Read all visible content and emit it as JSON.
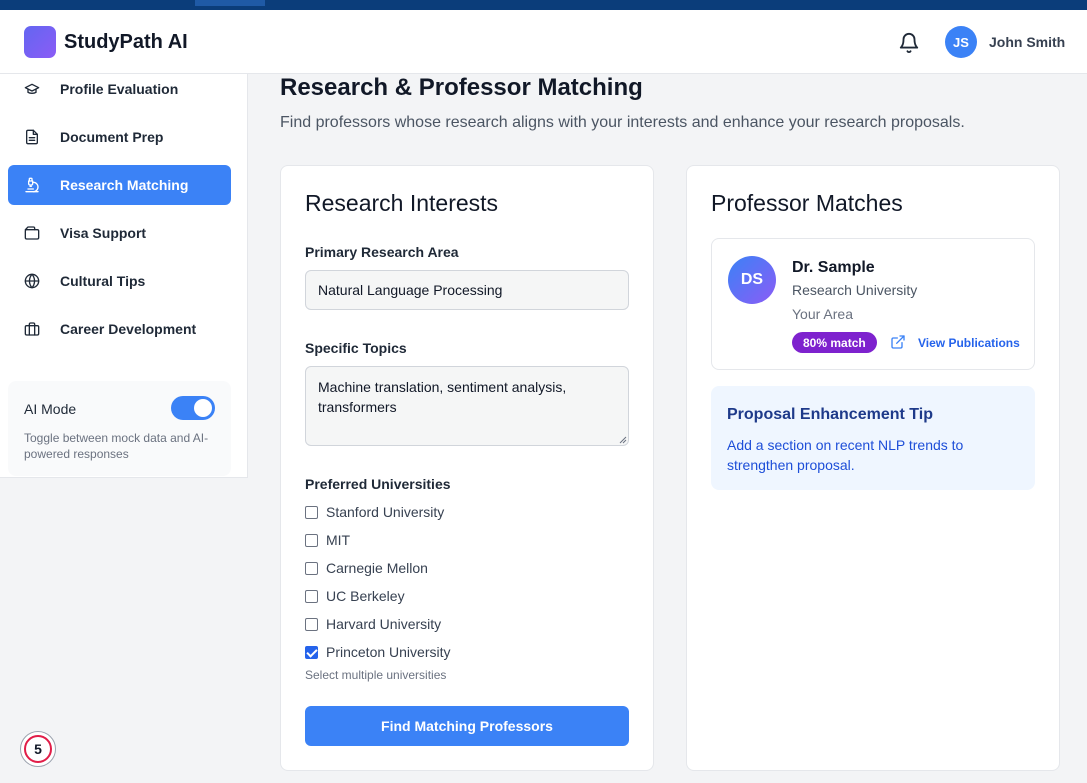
{
  "app": {
    "brand": "StudyPath AI"
  },
  "user": {
    "initials": "JS",
    "name": "John Smith"
  },
  "icons": {
    "notifications": "bell-icon",
    "external_link": "external-link-icon"
  },
  "colors": {
    "accent": "#3b82f6",
    "match_badge": "#7e22ce",
    "tip_bg": "#eff6ff"
  },
  "sidebar": {
    "items": [
      {
        "label": "Profile Evaluation",
        "icon": "graduation-cap-icon",
        "active": false
      },
      {
        "label": "Document Prep",
        "icon": "document-icon",
        "active": false
      },
      {
        "label": "Research Matching",
        "icon": "microscope-icon",
        "active": true
      },
      {
        "label": "Visa Support",
        "icon": "wallet-icon",
        "active": false
      },
      {
        "label": "Cultural Tips",
        "icon": "globe-icon",
        "active": false
      },
      {
        "label": "Career Development",
        "icon": "briefcase-icon",
        "active": false
      }
    ],
    "ai_mode": {
      "label": "AI Mode",
      "enabled": true,
      "description": "Toggle between mock data and AI-powered responses"
    }
  },
  "page": {
    "title": "Research & Professor Matching",
    "subtitle": "Find professors whose research aligns with your interests and enhance your research proposals."
  },
  "interests": {
    "heading": "Research Interests",
    "primary_label": "Primary Research Area",
    "primary_value": "Natural Language Processing",
    "topics_label": "Specific Topics",
    "topics_value": "Machine translation, sentiment analysis, transformers",
    "universities_label": "Preferred Universities",
    "universities": [
      {
        "name": "Stanford University",
        "checked": false
      },
      {
        "name": "MIT",
        "checked": false
      },
      {
        "name": "Carnegie Mellon",
        "checked": false
      },
      {
        "name": "UC Berkeley",
        "checked": false
      },
      {
        "name": "Harvard University",
        "checked": false
      },
      {
        "name": "Princeton University",
        "checked": true
      }
    ],
    "universities_hint": "Select multiple universities",
    "submit_label": "Find Matching Professors"
  },
  "matches": {
    "heading": "Professor Matches",
    "professor": {
      "initials": "DS",
      "name": "Dr. Sample",
      "university": "Research University",
      "area": "Your Area",
      "match": "80% match",
      "publications_link": "View Publications"
    },
    "tip": {
      "title": "Proposal Enhancement Tip",
      "text": "Add a section on recent NLP trends to strengthen proposal."
    }
  },
  "floating_badge": {
    "count": "5"
  }
}
